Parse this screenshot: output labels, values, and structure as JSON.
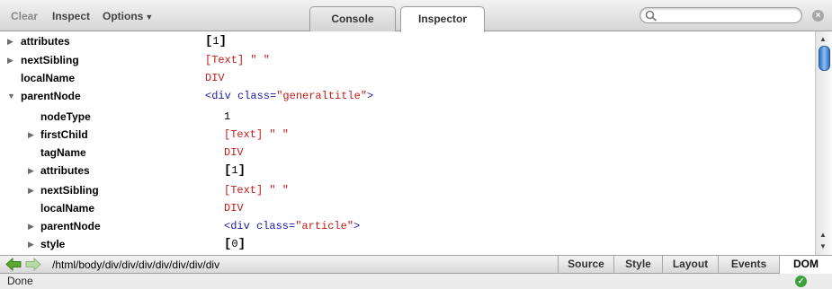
{
  "toolbar": {
    "clear_label": "Clear",
    "inspect_label": "Inspect",
    "options_label": "Options",
    "search_placeholder": "",
    "tabs": [
      {
        "label": "Console",
        "active": false
      },
      {
        "label": "Inspector",
        "active": true
      }
    ]
  },
  "rows": [
    {
      "key": "attributes",
      "value": "[1]",
      "arrow": "collapsed",
      "type": "array",
      "bracket_open": "[",
      "count": "1",
      "bracket_close": "]"
    },
    {
      "key": "nextSibling",
      "value": "[Text] \" \"",
      "arrow": "collapsed",
      "type": "red"
    },
    {
      "key": "localName",
      "value": "DIV",
      "arrow": "none",
      "type": "red"
    },
    {
      "key": "parentNode",
      "value_tag": "<div class=",
      "value_attr": "\"generaltitle\"",
      "value_end": ">",
      "arrow": "expanded",
      "type": "node"
    },
    {
      "key": "nodeType",
      "value": "1",
      "arrow": "none",
      "type": "number"
    },
    {
      "key": "firstChild",
      "value": "[Text] \" \"",
      "arrow": "collapsed",
      "type": "red"
    },
    {
      "key": "tagName",
      "value": "DIV",
      "arrow": "none",
      "type": "red"
    },
    {
      "key": "attributes",
      "value": "[1]",
      "arrow": "collapsed",
      "type": "array",
      "bracket_open": "[",
      "count": "1",
      "bracket_close": "]"
    },
    {
      "key": "nextSibling",
      "value": "[Text] \" \"",
      "arrow": "collapsed",
      "type": "red"
    },
    {
      "key": "localName",
      "value": "DIV",
      "arrow": "none",
      "type": "red"
    },
    {
      "key": "parentNode",
      "value_tag": "<div class=",
      "value_attr": "\"article\"",
      "value_end": ">",
      "arrow": "collapsed",
      "type": "node"
    },
    {
      "key": "style",
      "value": "[0]",
      "arrow": "collapsed",
      "type": "array",
      "bracket_open": "[",
      "count": "0",
      "bracket_close": "]"
    }
  ],
  "navbar": {
    "path": "/html/body/div/div/div/div/div/div/div",
    "segments": [
      "Source",
      "Style",
      "Layout",
      "Events",
      "DOM"
    ],
    "active_segment": "DOM"
  },
  "status": {
    "text": "Done"
  },
  "colors": {
    "accent": "#2f6fc4",
    "value_red": "#c41a16",
    "value_blue": "#1a1aa6",
    "status_ok": "#3ca33c",
    "nav_arrow": "#5aa832"
  },
  "icons": {
    "search": "magnifier-icon",
    "clear": "clear-search-icon",
    "back": "back-arrow-icon",
    "forward": "forward-arrow-icon",
    "status": "checkmark-icon"
  }
}
